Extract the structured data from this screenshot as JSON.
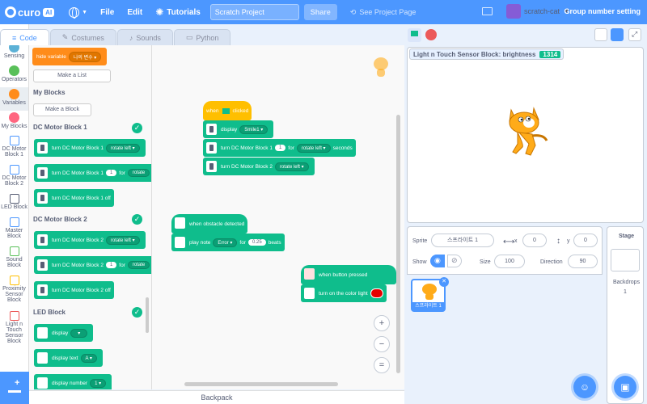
{
  "menubar": {
    "brand": "curo",
    "brand_badge": "AI",
    "file": "File",
    "edit": "Edit",
    "tutorials": "Tutorials",
    "project_title": "Scratch Project",
    "share": "Share",
    "see_project_page": "See Project Page",
    "username": "scratch-cat",
    "group_number_setting": "Group number setting"
  },
  "tabs": {
    "code": "Code",
    "costumes": "Costumes",
    "sounds": "Sounds",
    "python": "Python"
  },
  "categories": [
    {
      "label": "Sensing",
      "color": "#5cb1d6"
    },
    {
      "label": "Operators",
      "color": "#59c059"
    },
    {
      "label": "Variables",
      "color": "#ff8c1a"
    },
    {
      "label": "My Blocks",
      "color": "#ff6680"
    },
    {
      "label": "DC Motor Block 1"
    },
    {
      "label": "DC Motor Block 2"
    },
    {
      "label": "LED Block"
    },
    {
      "label": "Master Block"
    },
    {
      "label": "Sound Block"
    },
    {
      "label": "Proximity Sensor Block"
    },
    {
      "label": "Light n Touch Sensor Block"
    }
  ],
  "palette": {
    "hide_variable": "hide variable",
    "hide_variable_arg": "나의 변수",
    "make_list": "Make a List",
    "my_blocks_heading": "My Blocks",
    "make_block": "Make a Block",
    "dc1_heading": "DC Motor Block 1",
    "dc2_heading": "DC Motor Block 2",
    "led_heading": "LED Block",
    "blocks": {
      "dc1_turn": "turn DC Motor Block 1",
      "dc1_turn_dir": "rotate left",
      "dc1_turn_for": "turn DC Motor Block 1",
      "dc1_turn_for_num": "1",
      "dc1_turn_for_word": "for",
      "dc1_turn_for_dir": "rotate",
      "dc1_off": "turn DC Motor Block 1 off",
      "dc2_turn": "turn DC Motor Block 2",
      "dc2_turn_dir": "rotate left",
      "dc2_turn_for": "turn DC Motor Block 2",
      "dc2_turn_for_num": "1",
      "dc2_turn_for_word": "for",
      "dc2_turn_for_dir": "rotate",
      "dc2_off": "turn DC Motor Block 2 off",
      "display": "display",
      "display_text": "display text",
      "display_text_arg": "A",
      "display_number": "display number",
      "display_number_arg": "1"
    }
  },
  "script": {
    "when_clicked_pre": "when",
    "when_clicked_post": "clicked",
    "display": "display",
    "display_arg": "Smile1",
    "turn1": "turn DC Motor Block 1",
    "turn1_num": "1",
    "turn1_for": "for",
    "turn1_dir": "rotate left",
    "turn1_seconds": "seconds",
    "turn2": "turn DC Motor Block 2",
    "turn2_dir": "rotate left",
    "obstacle": "when obstacle detected",
    "play_note": "play note",
    "play_note_arg": "Error",
    "play_note_for": "for",
    "play_note_beats_val": "0.25",
    "play_note_beats": "beats",
    "button_pressed": "when button pressed",
    "turn_on_light": "turn on the color light",
    "light_color": "#e60000"
  },
  "zoom": {
    "in": "+",
    "out": "−",
    "reset": "="
  },
  "stage": {
    "monitor_label": "Light n Touch Sensor Block: brightness",
    "monitor_value": "1314"
  },
  "sprite_info": {
    "sprite_label": "Sprite",
    "sprite_name": "스프라이트 1",
    "x_label": "x",
    "x_value": "0",
    "y_label": "y",
    "y_value": "0",
    "show_label": "Show",
    "size_label": "Size",
    "size_value": "100",
    "direction_label": "Direction",
    "direction_value": "90",
    "thumb_label": "스프라이트 1"
  },
  "stage_pane": {
    "title": "Stage",
    "backdrops_label": "Backdrops",
    "backdrops_count": "1"
  },
  "backpack": "Backpack"
}
